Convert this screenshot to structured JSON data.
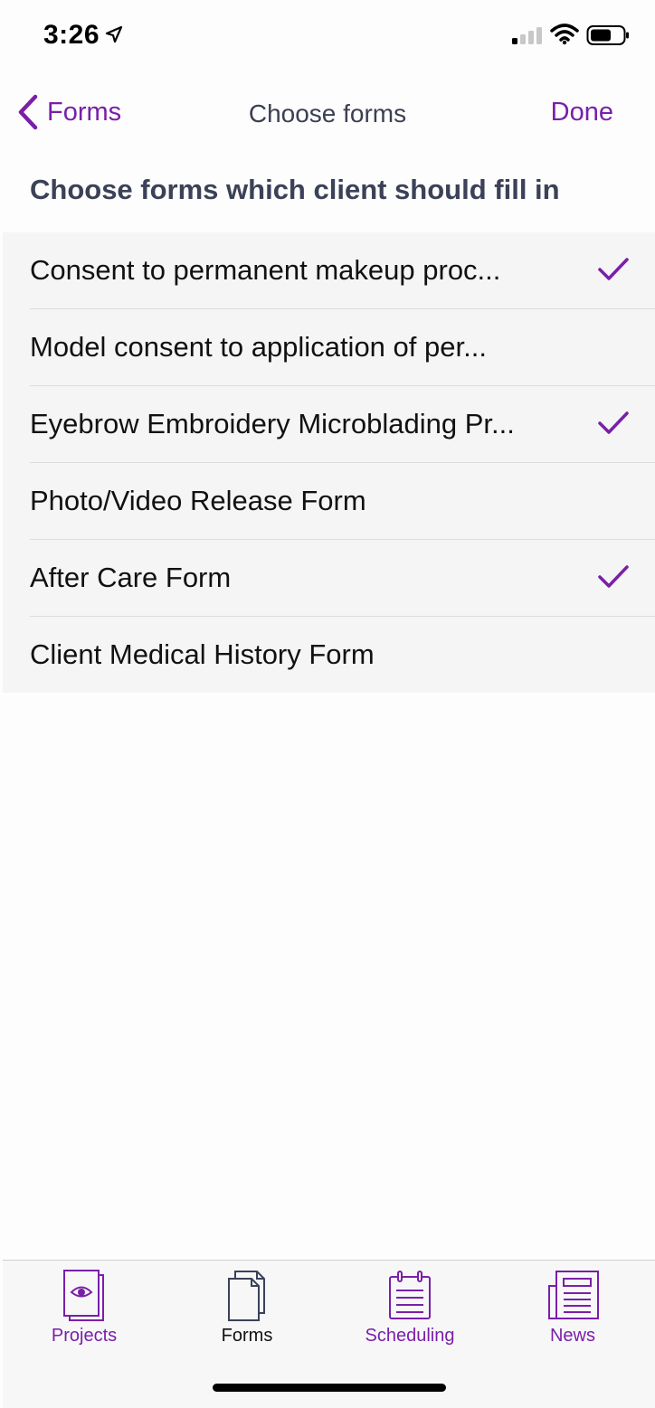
{
  "status": {
    "time": "3:26"
  },
  "nav": {
    "back_label": "Forms",
    "title": "Choose forms",
    "done_label": "Done"
  },
  "section": {
    "header": "Choose forms which client should fill in"
  },
  "forms": [
    {
      "label": "Consent to permanent makeup proc...",
      "checked": true
    },
    {
      "label": "Model consent to application of per...",
      "checked": false
    },
    {
      "label": "Eyebrow Embroidery Microblading Pr...",
      "checked": true
    },
    {
      "label": "Photo/Video Release Form",
      "checked": false
    },
    {
      "label": "After Care Form",
      "checked": true
    },
    {
      "label": "Client Medical History Form",
      "checked": false
    }
  ],
  "tabs": [
    {
      "label": "Projects",
      "icon": "projects-icon",
      "active": false
    },
    {
      "label": "Forms",
      "icon": "forms-icon",
      "active": true
    },
    {
      "label": "Scheduling",
      "icon": "scheduling-icon",
      "active": false
    },
    {
      "label": "News",
      "icon": "news-icon",
      "active": false
    }
  ],
  "colors": {
    "accent": "#7a1fa8",
    "title": "#3b4257",
    "list_bg": "#f5f5f6"
  }
}
